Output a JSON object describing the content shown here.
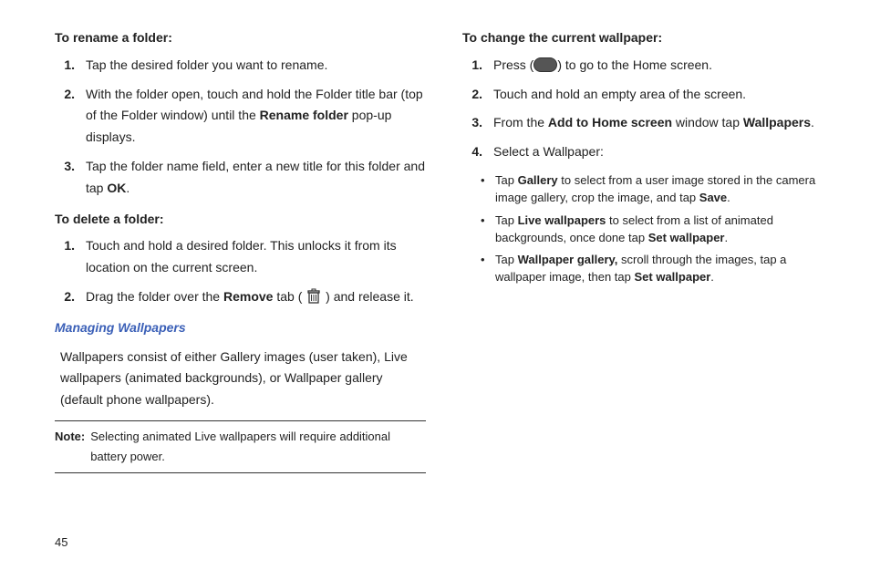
{
  "left": {
    "rename_head": "To rename a folder:",
    "rename_steps": [
      {
        "n": "1.",
        "t": "Tap the desired folder you want to rename."
      },
      {
        "n": "2.",
        "t_pre": "With the folder open, touch and hold the Folder title bar (top of the Folder window) until the ",
        "b1": "Rename folder",
        "t_post": " pop-up displays."
      },
      {
        "n": "3.",
        "t_pre": "Tap the folder name field, enter a new title for this folder and tap ",
        "b1": "OK",
        "t_post": "."
      }
    ],
    "delete_head": "To delete a folder:",
    "delete_steps": [
      {
        "n": "1.",
        "t": "Touch and hold a desired folder. This unlocks it from its location on the current screen."
      },
      {
        "n": "2.",
        "t_pre": "Drag the folder over the ",
        "b1": "Remove",
        "t_mid": " tab ( ",
        "icon": "trash",
        "t_post": " ) and release it."
      }
    ],
    "section_title": "Managing Wallpapers",
    "para": "Wallpapers consist of either Gallery images (user taken), Live wallpapers (animated backgrounds), or Wallpaper gallery (default phone wallpapers).",
    "note_label": "Note:",
    "note_text": "Selecting animated Live wallpapers will require additional battery power."
  },
  "right": {
    "change_head": "To change the current wallpaper:",
    "steps": [
      {
        "n": "1.",
        "t_pre": "Press (",
        "icon": "home",
        "t_post": ") to go to the Home screen."
      },
      {
        "n": "2.",
        "t": "Touch and hold an empty area of the screen."
      },
      {
        "n": "3.",
        "t_pre": "From the ",
        "b1": "Add to Home screen",
        "t_mid": " window tap ",
        "b2": "Wallpapers",
        "t_post": "."
      },
      {
        "n": "4.",
        "t": "Select a Wallpaper:"
      }
    ],
    "bullets": [
      {
        "t_pre": "Tap ",
        "b1": "Gallery",
        "t_mid": " to select from a user image stored in the camera image gallery, crop the image, and tap ",
        "b2": "Save",
        "t_post": "."
      },
      {
        "t_pre": "Tap ",
        "b1": "Live wallpapers",
        "t_mid": " to select from a list of animated backgrounds, once done tap ",
        "b2": "Set wallpaper",
        "t_post": "."
      },
      {
        "t_pre": "Tap ",
        "b1": "Wallpaper gallery,",
        "t_mid": " scroll through the images, tap a wallpaper image, then tap ",
        "b2": "Set wallpaper",
        "t_post": "."
      }
    ]
  },
  "page_number": "45"
}
